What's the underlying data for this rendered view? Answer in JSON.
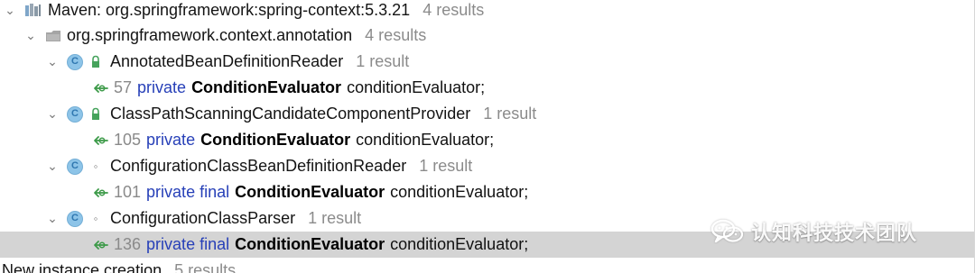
{
  "search_results": {
    "maven_library": {
      "label": "Maven: org.springframework:spring-context:5.3.21",
      "count": "4 results",
      "icon": "library-icon"
    },
    "package": {
      "label": "org.springframework.context.annotation",
      "count": "4 results",
      "icon": "package-icon"
    },
    "classes": [
      {
        "name": "AnnotatedBeanDefinitionReader",
        "count": "1 result",
        "usage": {
          "line": "57",
          "modifiers": "private",
          "type": "ConditionEvaluator",
          "field": "conditionEvaluator;"
        }
      },
      {
        "name": "ClassPathScanningCandidateComponentProvider",
        "count": "1 result",
        "usage": {
          "line": "105",
          "modifiers": "private",
          "type": "ConditionEvaluator",
          "field": "conditionEvaluator;"
        }
      },
      {
        "name": "ConfigurationClassBeanDefinitionReader",
        "count": "1 result",
        "usage": {
          "line": "101",
          "modifiers": "private final",
          "type": "ConditionEvaluator",
          "field": "conditionEvaluator;"
        }
      },
      {
        "name": "ConfigurationClassParser",
        "count": "1 result",
        "usage": {
          "line": "136",
          "modifiers": "private final",
          "type": "ConditionEvaluator",
          "field": "conditionEvaluator;"
        }
      }
    ],
    "next_group": {
      "label": "New instance creation",
      "count": "5 results"
    }
  },
  "watermark": {
    "text": "认知科技技术团队"
  },
  "colors": {
    "keyword": "#2740b8",
    "selected_row": "#d4d4d4",
    "count": "#8b8b8b",
    "class_icon": "#8dc4e8",
    "usage_icon": "#3c9a48"
  }
}
